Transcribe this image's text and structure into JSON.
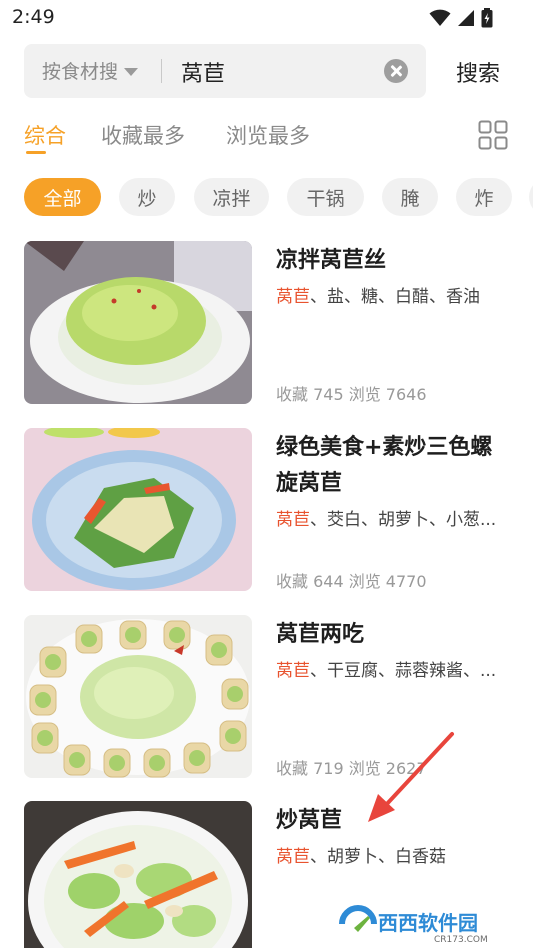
{
  "status": {
    "time": "2:49"
  },
  "search": {
    "mode_label": "按食材搜",
    "query": "莴苣",
    "button": "搜索"
  },
  "sort_tabs": [
    "综合",
    "收藏最多",
    "浏览最多"
  ],
  "chips": [
    "全部",
    "炒",
    "凉拌",
    "干锅",
    "腌",
    "炸"
  ],
  "recipes": [
    {
      "title": "凉拌莴苣丝",
      "main": "莴苣",
      "rest": "、盐、糖、白醋、香油",
      "meta": "收藏 745 浏览 7646"
    },
    {
      "title": "绿色美食+素炒三色螺旋莴苣",
      "main": "莴苣",
      "rest": "、茭白、胡萝卜、小葱...",
      "meta": "收藏 644 浏览 4770"
    },
    {
      "title": "莴苣两吃",
      "main": "莴苣",
      "rest": "、干豆腐、蒜蓉辣酱、...",
      "meta": "收藏 719 浏览 2627"
    },
    {
      "title": "炒莴苣",
      "main": "莴苣",
      "rest": "、胡萝卜、白香菇",
      "meta": ""
    }
  ],
  "watermark": {
    "text": "西西软件园",
    "sub": "CR173.COM"
  },
  "colors": {
    "accent": "#f6a127",
    "ingredient_highlight": "#e8532f",
    "arrow": "#e8453c"
  }
}
